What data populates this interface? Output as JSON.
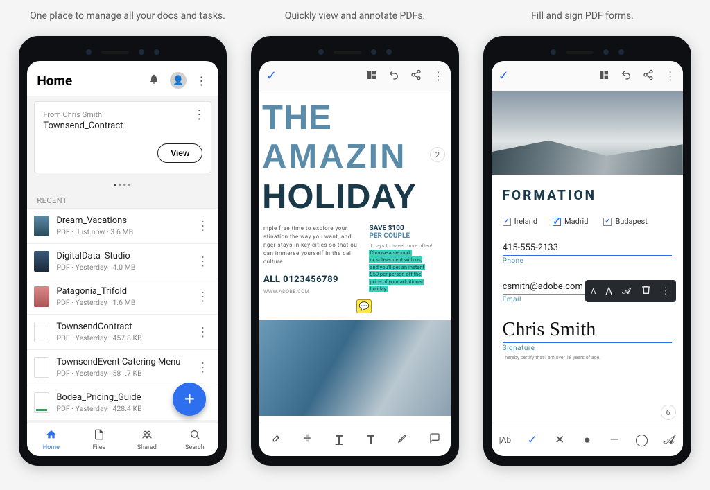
{
  "captions": [
    "One place to manage all your docs and tasks.",
    "Quickly view and annotate PDFs.",
    "Fill and sign PDF forms."
  ],
  "phone1": {
    "title": "Home",
    "card": {
      "from": "From Chris Smith",
      "filename": "Townsend_Contract",
      "view": "View"
    },
    "recent_label": "RECENT",
    "files": [
      {
        "name": "Dream_Vacations",
        "type": "PDF",
        "when": "Just now",
        "size": "3.6 MB"
      },
      {
        "name": "DigitalData_Studio",
        "type": "PDF",
        "when": "Yesterday",
        "size": "4.0 MB"
      },
      {
        "name": "Patagonia_Trifold",
        "type": "PDF",
        "when": "Yesterday",
        "size": "1.6 MB"
      },
      {
        "name": "TownsendContract",
        "type": "PDF",
        "when": "Yesterday",
        "size": "457.8 KB"
      },
      {
        "name": "TownsendEvent Catering Menu",
        "type": "PDF",
        "when": "Yesterday",
        "size": "581.7 KB"
      },
      {
        "name": "Bodea_Pricing_Guide",
        "type": "PDF",
        "when": "Yesterday",
        "size": "428.4 KB"
      }
    ],
    "nav": {
      "home": "Home",
      "files": "Files",
      "shared": "Shared",
      "search": "Search"
    }
  },
  "phone2": {
    "page_badge": "2",
    "heading": {
      "line1": "THE",
      "line2": "AMAZIN",
      "line3": "HOLIDAY"
    },
    "left_copy": "mple free time to explore your stination the way you want, and nger stays in key cities so that ou can immerse yourself in the cal culture",
    "call_title": "ALL 0123456789",
    "url": "WWW.ADOBE.COM",
    "right": {
      "save1": "SAVE $100",
      "save2": "PER COUPLE",
      "grey": "It pays to travel more often!",
      "hl1": "Choose a second,",
      "hl2": "or subsequent with us,",
      "hl3": "and you'll get an instant",
      "hl4": "$50 per person off the",
      "hl5": "price of your additional",
      "hl6": "holiday."
    }
  },
  "phone3": {
    "heading_fragment": "FORMATION",
    "checks": [
      "Ireland",
      "Madrid",
      "Budapest"
    ],
    "phone_val": "415-555-2133",
    "phone_label": "Phone",
    "email_val": "csmith@adobe.com",
    "email_label": "Email",
    "signature": "Chris Smith",
    "sig_label": "Signature",
    "cert": "I hereby certify that I am over 18 years of age.",
    "page_badge": "6"
  }
}
